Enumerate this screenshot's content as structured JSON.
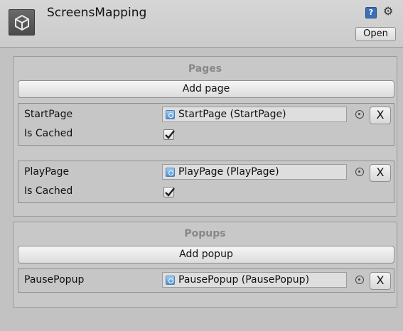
{
  "header": {
    "title": "ScreensMapping",
    "open_label": "Open",
    "icons": [
      "unity-logo-icon",
      "help-icon",
      "gear-icon"
    ]
  },
  "pages": {
    "title": "Pages",
    "add_label": "Add page",
    "items": [
      {
        "name": "StartPage",
        "object": "StartPage (StartPage)",
        "cached_label": "Is Cached",
        "is_cached": true,
        "remove_label": "X"
      },
      {
        "name": "PlayPage",
        "object": "PlayPage (PlayPage)",
        "cached_label": "Is Cached",
        "is_cached": true,
        "remove_label": "X"
      }
    ]
  },
  "popups": {
    "title": "Popups",
    "add_label": "Add popup",
    "items": [
      {
        "name": "PausePopup",
        "object": "PausePopup (PausePopup)",
        "remove_label": "X"
      }
    ]
  }
}
